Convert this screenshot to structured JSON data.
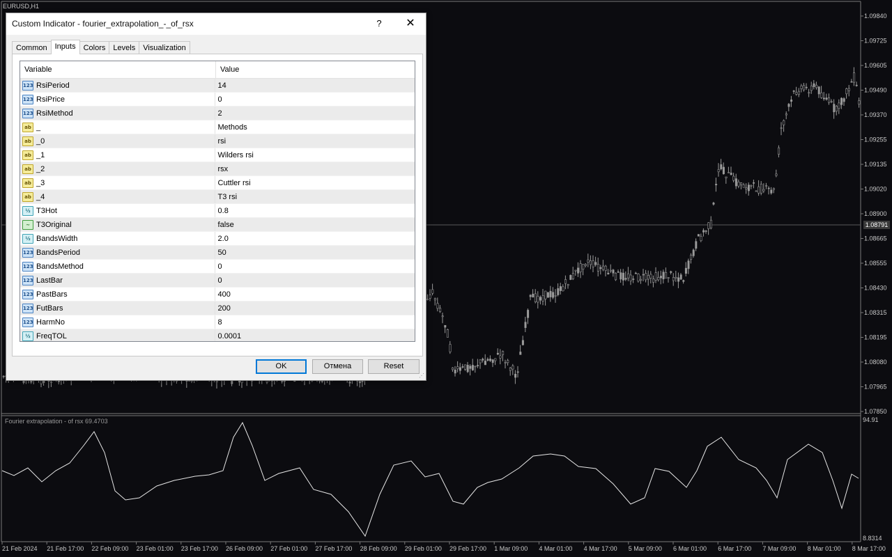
{
  "chart": {
    "symbol": "EURUSD,H1",
    "indicator_label": "Fourier extrapolation - of rsx 69.4703",
    "current_price": "1.08791",
    "price_ticks": [
      "1.09840",
      "1.09725",
      "1.09605",
      "1.09490",
      "1.09370",
      "1.09255",
      "1.09135",
      "1.09020",
      "1.08900",
      "1.08665",
      "1.08555",
      "1.08430",
      "1.08315",
      "1.08195",
      "1.08080",
      "1.07965",
      "1.07850"
    ],
    "indicator_ticks": [
      "94.91",
      "8.8314"
    ],
    "time_ticks": [
      "21 Feb 2024",
      "21 Feb 17:00",
      "22 Feb 09:00",
      "23 Feb 01:00",
      "23 Feb 17:00",
      "26 Feb 09:00",
      "27 Feb 01:00",
      "27 Feb 17:00",
      "28 Feb 09:00",
      "29 Feb 01:00",
      "29 Feb 17:00",
      "1 Mar 09:00",
      "4 Mar 01:00",
      "4 Mar 17:00",
      "5 Mar 09:00",
      "6 Mar 01:00",
      "6 Mar 17:00",
      "7 Mar 09:00",
      "8 Mar 01:00",
      "8 Mar 17:00"
    ],
    "bg_color": "#0c0c10",
    "candle_color": "#9a9a9a",
    "line_color": "#e6e6e6"
  },
  "dialog": {
    "title": "Custom Indicator - fourier_extrapolation_-_of_rsx",
    "help_label": "?",
    "close_label": "✕",
    "tabs": [
      {
        "label": "Common",
        "active": false
      },
      {
        "label": "Inputs",
        "active": true
      },
      {
        "label": "Colors",
        "active": false
      },
      {
        "label": "Levels",
        "active": false
      },
      {
        "label": "Visualization",
        "active": false
      }
    ],
    "columns": {
      "variable": "Variable",
      "value": "Value"
    },
    "inputs": [
      {
        "type": "int",
        "icon": "123",
        "name": "RsiPeriod",
        "value": "14"
      },
      {
        "type": "int",
        "icon": "123",
        "name": "RsiPrice",
        "value": "0"
      },
      {
        "type": "int",
        "icon": "123",
        "name": "RsiMethod",
        "value": "2"
      },
      {
        "type": "string",
        "icon": "ab",
        "name": "_",
        "value": "Methods"
      },
      {
        "type": "string",
        "icon": "ab",
        "name": "_0",
        "value": "rsi"
      },
      {
        "type": "string",
        "icon": "ab",
        "name": "_1",
        "value": "Wilders rsi"
      },
      {
        "type": "string",
        "icon": "ab",
        "name": "_2",
        "value": "rsx"
      },
      {
        "type": "string",
        "icon": "ab",
        "name": "_3",
        "value": "Cuttler rsi"
      },
      {
        "type": "string",
        "icon": "ab",
        "name": "_4",
        "value": "T3 rsi"
      },
      {
        "type": "double",
        "icon": "½",
        "name": "T3Hot",
        "value": "0.8"
      },
      {
        "type": "bool",
        "icon": "~",
        "name": "T3Original",
        "value": "false"
      },
      {
        "type": "double",
        "icon": "½",
        "name": "BandsWidth",
        "value": "2.0"
      },
      {
        "type": "int",
        "icon": "123",
        "name": "BandsPeriod",
        "value": "50"
      },
      {
        "type": "int",
        "icon": "123",
        "name": "BandsMethod",
        "value": "0"
      },
      {
        "type": "int",
        "icon": "123",
        "name": "LastBar",
        "value": "0"
      },
      {
        "type": "int",
        "icon": "123",
        "name": "PastBars",
        "value": "400"
      },
      {
        "type": "int",
        "icon": "123",
        "name": "FutBars",
        "value": "200"
      },
      {
        "type": "int",
        "icon": "123",
        "name": "HarmNo",
        "value": "8"
      },
      {
        "type": "double",
        "icon": "½",
        "name": "FreqTOL",
        "value": "0.0001"
      }
    ],
    "buttons": {
      "ok": "OK",
      "cancel": "Отмена",
      "reset": "Reset"
    }
  }
}
